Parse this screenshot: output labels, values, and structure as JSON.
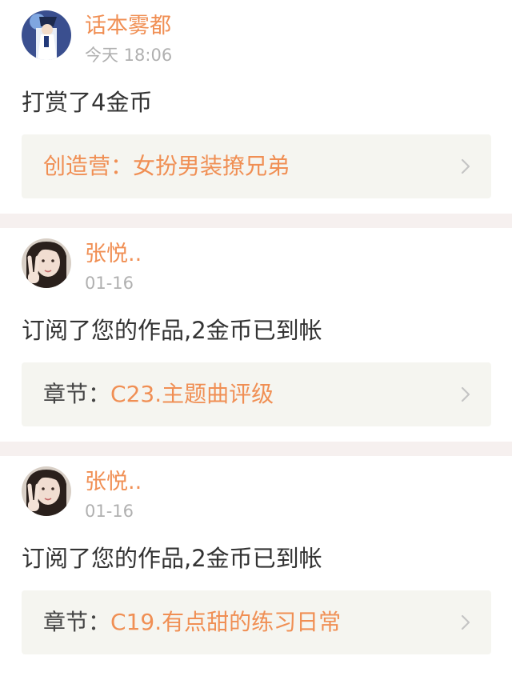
{
  "feed": {
    "items": [
      {
        "user": "话本雾都",
        "time": "今天 18:06",
        "message": "打赏了4金币",
        "ref_prefix": "",
        "ref_title": "创造营：女扮男装撩兄弟"
      },
      {
        "user": "张悦..",
        "time": "01-16",
        "message": "订阅了您的作品,2金币已到帐",
        "ref_prefix": "章节：",
        "ref_title": "C23.主题曲评级"
      },
      {
        "user": "张悦..",
        "time": "01-16",
        "message": "订阅了您的作品,2金币已到帐",
        "ref_prefix": "章节：",
        "ref_title": "C19.有点甜的练习日常"
      }
    ]
  },
  "colors": {
    "accent": "#f08f54",
    "separator": "#f6f0ef",
    "ref_background": "#f5f5f0",
    "muted_text": "#b0b0b0"
  },
  "icons": {
    "avatar_1": "avatar-icon",
    "avatar_2": "avatar-icon",
    "chevron": "chevron-right-icon"
  }
}
